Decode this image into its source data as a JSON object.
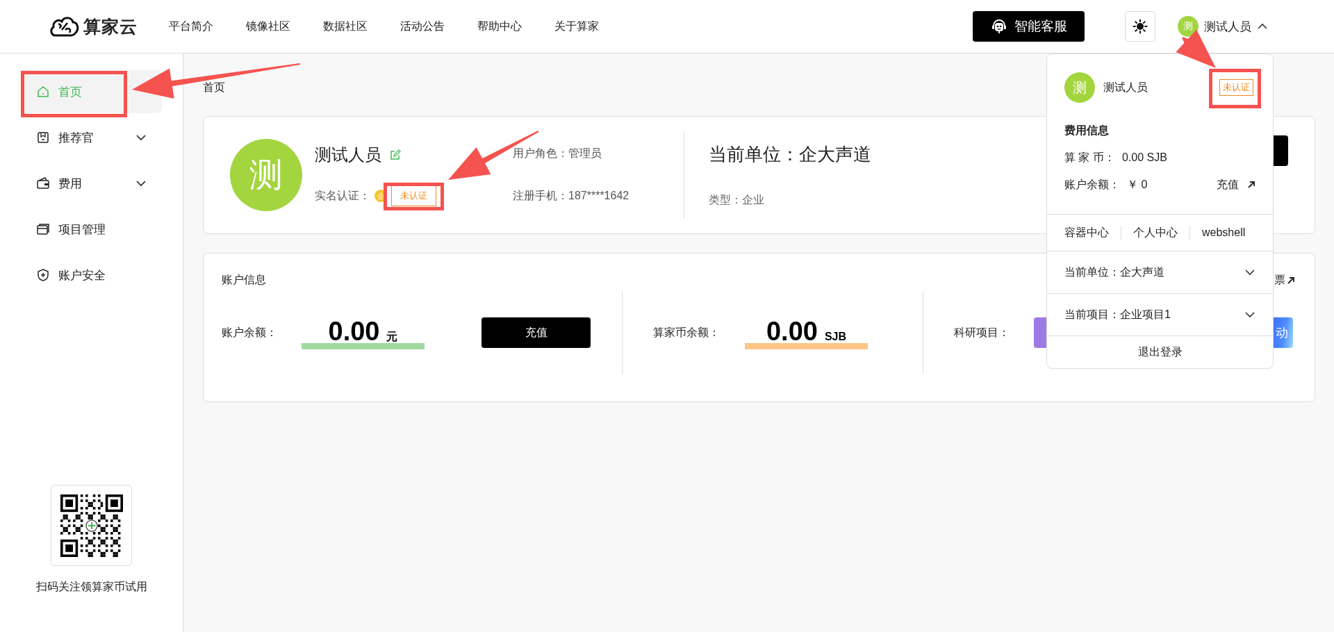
{
  "header": {
    "logo_text": "算家云",
    "nav": [
      "平台简介",
      "镜像社区",
      "数据社区",
      "活动公告",
      "帮助中心",
      "关于算家"
    ],
    "service_button": "智能客服",
    "user": {
      "avatar": "测",
      "name": "测试人员",
      "menu_open": true
    }
  },
  "sidebar": {
    "items": [
      {
        "label": "首页",
        "kind": "link",
        "selected": true,
        "highlighted": true
      },
      {
        "label": "推荐官",
        "kind": "group",
        "selected": false,
        "highlighted": false
      },
      {
        "label": "费用",
        "kind": "group",
        "selected": false,
        "highlighted": false
      },
      {
        "label": "项目管理",
        "kind": "link",
        "selected": false,
        "highlighted": false
      },
      {
        "label": "账户安全",
        "kind": "link",
        "selected": false,
        "highlighted": false
      }
    ],
    "qr_caption": "扫码关注领算家币试用"
  },
  "breadcrumb": "首页",
  "profile": {
    "avatar": "测",
    "name": "测试人员",
    "verify_label": "实名认证：",
    "verify_badge": "企",
    "verify_status": "未认证",
    "verify_highlighted": true,
    "role": "用户角色：管理员",
    "phone": "注册手机：187****1642",
    "unit": "当前单位：企大声道",
    "unit_type": "类型：企业"
  },
  "account": {
    "title": "账户信息",
    "invoice_link": "票",
    "blocks": [
      {
        "kind": "balance",
        "label": "账户余额：",
        "amount": "0.00",
        "unit": "元",
        "button": "充值"
      },
      {
        "kind": "coins",
        "label": "算家币余额：",
        "amount": "0.00",
        "unit": "SJB"
      },
      {
        "kind": "research",
        "label": "科研项目：",
        "cta": "动"
      }
    ]
  },
  "user_menu": {
    "avatar": "测",
    "name": "测试人员",
    "status": "未认证",
    "status_highlighted": true,
    "fee_title": "费用信息",
    "coins_label": "算 家 币：",
    "coins_value": "0.00 SJB",
    "balance_label": "账户余额：",
    "balance_value": "￥ 0",
    "recharge": "充值",
    "links": [
      "容器中心",
      "个人中心",
      "webshell"
    ],
    "selectors": [
      "当前单位：企大声道",
      "当前项目：企业项目1"
    ],
    "logout": "退出登录"
  }
}
